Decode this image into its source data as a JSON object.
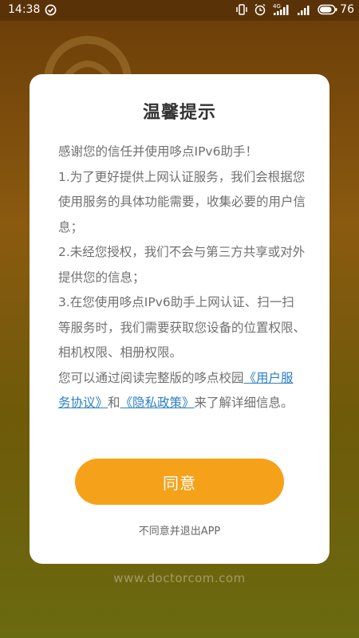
{
  "status_bar": {
    "time": "14:38",
    "signal_label": "4G",
    "battery": "76"
  },
  "background": {
    "footer_url": "www.doctorcom.com"
  },
  "dialog": {
    "title": "温馨提示",
    "paragraphs": {
      "intro": "感谢您的信任并使用哆点IPv6助手！",
      "item1": "1.为了更好提供上网认证服务，我们会根据您使用服务的具体功能需要，收集必要的用户信息；",
      "item2": "2.未经您授权，我们不会与第三方共享或对外提供您的信息；",
      "item3": "3.在您使用哆点IPv6助手上网认证、扫一扫等服务时，我们需要获取您设备的位置权限、相机权限、相册权限。",
      "outro_prefix": "您可以通过阅读完整版的哆点校园",
      "user_agreement_link": "《用户服务协议》",
      "outro_and": "和",
      "privacy_policy_link": "《隐私政策》",
      "outro_suffix": "来了解详细信息。"
    },
    "agree_button": "同意",
    "disagree_link": "不同意并退出APP"
  },
  "colors": {
    "accent": "#f5a21a",
    "link": "#2a7fc4",
    "background_top": "#6b3d08",
    "background_bottom": "#6a6a10"
  },
  "icons": {
    "status_left": [
      "check-circle-icon"
    ],
    "status_right": [
      "vibrate-icon",
      "alarm-icon",
      "signal-4g-icon",
      "signal-bars-icon",
      "battery-icon"
    ]
  }
}
